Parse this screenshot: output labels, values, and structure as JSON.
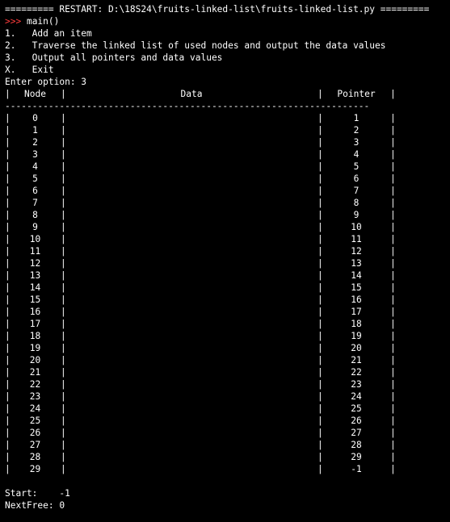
{
  "console": {
    "restart_line": "========= RESTART: D:\\18S24\\fruits-linked-list\\fruits-linked-list.py =========",
    "prompt": ">>>",
    "command": " main()",
    "menu": [
      "1.   Add an item",
      "2.   Traverse the linked list of used nodes and output the data values",
      "3.   Output all pointers and data values",
      "X.   Exit"
    ],
    "input_line": "Enter option: 3"
  },
  "table": {
    "headers": {
      "node": "Node",
      "data": "Data",
      "pointer": "Pointer"
    },
    "separator": "-------------------------------------------------------------------",
    "rows": [
      {
        "node": "0",
        "data": "",
        "pointer": "1"
      },
      {
        "node": "1",
        "data": "",
        "pointer": "2"
      },
      {
        "node": "2",
        "data": "",
        "pointer": "3"
      },
      {
        "node": "3",
        "data": "",
        "pointer": "4"
      },
      {
        "node": "4",
        "data": "",
        "pointer": "5"
      },
      {
        "node": "5",
        "data": "",
        "pointer": "6"
      },
      {
        "node": "6",
        "data": "",
        "pointer": "7"
      },
      {
        "node": "7",
        "data": "",
        "pointer": "8"
      },
      {
        "node": "8",
        "data": "",
        "pointer": "9"
      },
      {
        "node": "9",
        "data": "",
        "pointer": "10"
      },
      {
        "node": "10",
        "data": "",
        "pointer": "11"
      },
      {
        "node": "11",
        "data": "",
        "pointer": "12"
      },
      {
        "node": "12",
        "data": "",
        "pointer": "13"
      },
      {
        "node": "13",
        "data": "",
        "pointer": "14"
      },
      {
        "node": "14",
        "data": "",
        "pointer": "15"
      },
      {
        "node": "15",
        "data": "",
        "pointer": "16"
      },
      {
        "node": "16",
        "data": "",
        "pointer": "17"
      },
      {
        "node": "17",
        "data": "",
        "pointer": "18"
      },
      {
        "node": "18",
        "data": "",
        "pointer": "19"
      },
      {
        "node": "19",
        "data": "",
        "pointer": "20"
      },
      {
        "node": "20",
        "data": "",
        "pointer": "21"
      },
      {
        "node": "21",
        "data": "",
        "pointer": "22"
      },
      {
        "node": "22",
        "data": "",
        "pointer": "23"
      },
      {
        "node": "23",
        "data": "",
        "pointer": "24"
      },
      {
        "node": "24",
        "data": "",
        "pointer": "25"
      },
      {
        "node": "25",
        "data": "",
        "pointer": "26"
      },
      {
        "node": "26",
        "data": "",
        "pointer": "27"
      },
      {
        "node": "27",
        "data": "",
        "pointer": "28"
      },
      {
        "node": "28",
        "data": "",
        "pointer": "29"
      },
      {
        "node": "29",
        "data": "",
        "pointer": "-1"
      }
    ]
  },
  "footer": {
    "start_label": "Start:",
    "start_value": "-1",
    "nextfree_label": "NextFree:",
    "nextfree_value": "0"
  },
  "colors": {
    "background": "#000000",
    "text": "#ffffff",
    "prompt": "#ff3c3c"
  }
}
